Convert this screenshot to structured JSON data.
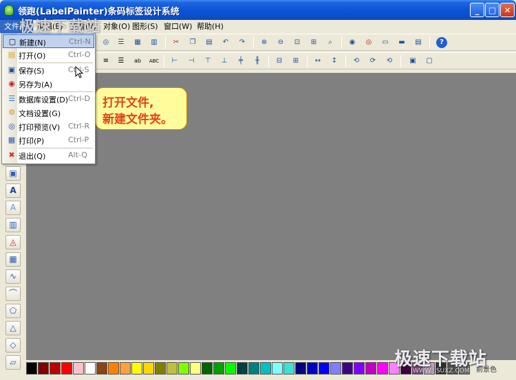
{
  "window": {
    "title": "领跑(LabelPainter)条码标签设计系统",
    "minimize_glyph": "_",
    "maximize_glyph": "□",
    "close_glyph": "✕"
  },
  "menubar": {
    "items": [
      {
        "label": "文件(F)"
      },
      {
        "label": "编辑(E)"
      },
      {
        "label": "查看(V)"
      },
      {
        "label": "对象(O)"
      },
      {
        "label": "图形(S)"
      },
      {
        "label": "窗口(W)"
      },
      {
        "label": "帮助(H)"
      }
    ]
  },
  "file_menu": {
    "items": [
      {
        "label": "新建(N)",
        "shortcut": "Ctrl-N",
        "icon": "new-file-icon",
        "glyph": "▢"
      },
      {
        "label": "打开(O)",
        "shortcut": "Ctrl-O",
        "icon": "open-folder-icon",
        "glyph": "▤"
      },
      {
        "label": "保存(S)",
        "shortcut": "Ctrl-S",
        "icon": "save-icon",
        "glyph": "▣"
      },
      {
        "label": "另存为(A)",
        "shortcut": "",
        "icon": "save-as-icon",
        "glyph": "◉"
      },
      {
        "label": "数据库设置(D)",
        "shortcut": "Ctrl-D",
        "icon": "database-icon",
        "glyph": "☰"
      },
      {
        "label": "文档设置(G)",
        "shortcut": "",
        "icon": "gear-icon",
        "glyph": "⚙"
      },
      {
        "label": "打印预览(V)",
        "shortcut": "Ctrl-R",
        "icon": "print-preview-icon",
        "glyph": "◎"
      },
      {
        "label": "打印(P)",
        "shortcut": "Ctrl-P",
        "icon": "printer-icon",
        "glyph": "▦"
      },
      {
        "label": "退出(Q)",
        "shortcut": "Alt-Q",
        "icon": "exit-icon",
        "glyph": "✖"
      }
    ]
  },
  "callout": {
    "line1": "打开文件,",
    "line2": "新建文件夹。"
  },
  "toolbar1": {
    "icons": [
      {
        "name": "print-preview-icon",
        "glyph": "◎"
      },
      {
        "name": "database-icon",
        "glyph": "☰"
      },
      {
        "name": "grid-icon",
        "glyph": "▦"
      },
      {
        "name": "calculator-icon",
        "glyph": "▥"
      },
      {
        "name": "cut-icon",
        "glyph": "✂"
      },
      {
        "name": "copy-icon",
        "glyph": "❐"
      },
      {
        "name": "paste-icon",
        "glyph": "▤"
      },
      {
        "name": "undo-icon",
        "glyph": "↶"
      },
      {
        "name": "redo-icon",
        "glyph": "↷"
      },
      {
        "name": "zoom-in-icon",
        "glyph": "⊕"
      },
      {
        "name": "zoom-out-icon",
        "glyph": "⊖"
      },
      {
        "name": "zoom-fit-icon",
        "glyph": "⊡"
      },
      {
        "name": "zoom-page-icon",
        "glyph": "⊞"
      },
      {
        "name": "zoom-select-icon",
        "glyph": "⌕"
      },
      {
        "name": "show-icon",
        "glyph": "◉"
      },
      {
        "name": "hide-icon",
        "glyph": "◎"
      },
      {
        "name": "layer-up-icon",
        "glyph": "▭"
      },
      {
        "name": "layer-down-icon",
        "glyph": "▬"
      },
      {
        "name": "properties-icon",
        "glyph": "▤"
      },
      {
        "name": "help-icon",
        "glyph": "?"
      }
    ]
  },
  "toolbar2": {
    "icons": [
      {
        "name": "align-center-text-icon",
        "glyph": "≡"
      },
      {
        "name": "align-justify-text-icon",
        "glyph": "☰"
      },
      {
        "name": "text-spacing-icon",
        "glyph": "ab"
      },
      {
        "name": "text-abc-icon",
        "glyph": "ABC"
      },
      {
        "name": "align-left-icon",
        "glyph": "⊢"
      },
      {
        "name": "align-right-icon",
        "glyph": "⊣"
      },
      {
        "name": "align-top-icon",
        "glyph": "⊤"
      },
      {
        "name": "align-bottom-icon",
        "glyph": "⊥"
      },
      {
        "name": "center-horizontal-icon",
        "glyph": "╪"
      },
      {
        "name": "center-vertical-icon",
        "glyph": "╫"
      },
      {
        "name": "distribute-h-icon",
        "glyph": "⊟"
      },
      {
        "name": "distribute-v-icon",
        "glyph": "⊞"
      },
      {
        "name": "same-width-icon",
        "glyph": "↔"
      },
      {
        "name": "same-height-icon",
        "glyph": "↕"
      },
      {
        "name": "rotate-90-icon",
        "glyph": "⟲"
      },
      {
        "name": "rotate-180-icon",
        "glyph": "⟳"
      },
      {
        "name": "rotate-270-icon",
        "glyph": "⟲"
      },
      {
        "name": "group-icon",
        "glyph": "▣"
      },
      {
        "name": "ungroup-icon",
        "glyph": "▢"
      }
    ]
  },
  "toolbox": {
    "tools": [
      {
        "name": "image-tool-icon",
        "glyph": "▣"
      },
      {
        "name": "text-tool-icon",
        "glyph": "A"
      },
      {
        "name": "outline-text-tool-icon",
        "glyph": "A"
      },
      {
        "name": "barcode-tool-icon",
        "glyph": "▥"
      },
      {
        "name": "arc-text-tool-icon",
        "glyph": "◬"
      },
      {
        "name": "qrcode-tool-icon",
        "glyph": "▦"
      },
      {
        "name": "curve-tool-icon",
        "glyph": "∿"
      },
      {
        "name": "arc-tool-icon",
        "glyph": "⌒"
      },
      {
        "name": "polygon-tool-icon",
        "glyph": "⬠"
      },
      {
        "name": "triangle-tool-icon",
        "glyph": "△"
      },
      {
        "name": "diamond-tool-icon",
        "glyph": "◇"
      },
      {
        "name": "parallelogram-tool-icon",
        "glyph": "▱"
      }
    ]
  },
  "palette": {
    "colors": [
      "#000000",
      "#800000",
      "#c00000",
      "#ff0000",
      "#ffc0cb",
      "#ffffff",
      "#8b4513",
      "#ff8000",
      "#ffa040",
      "#ffff00",
      "#ffd700",
      "#808000",
      "#c0c040",
      "#80ff00",
      "#ffff80",
      "#006400",
      "#00a000",
      "#00ff00",
      "#004040",
      "#008080",
      "#00c0c0",
      "#80ffff",
      "#40e0d0",
      "#000080",
      "#0000c0",
      "#0000ff",
      "#8080ff",
      "#400080",
      "#8000ff",
      "#c000c0",
      "#ff00ff",
      "#ff80ff",
      "#400040",
      "#804080",
      "#c0a0c0",
      "#303030",
      "#505050",
      "#707070",
      "#909090",
      "#b0b0b0"
    ],
    "bg_label": "前景色"
  },
  "watermark": {
    "top": "极速下载站",
    "bottom": "极速下载站",
    "url": "WWW.JISUXZ.COM"
  }
}
